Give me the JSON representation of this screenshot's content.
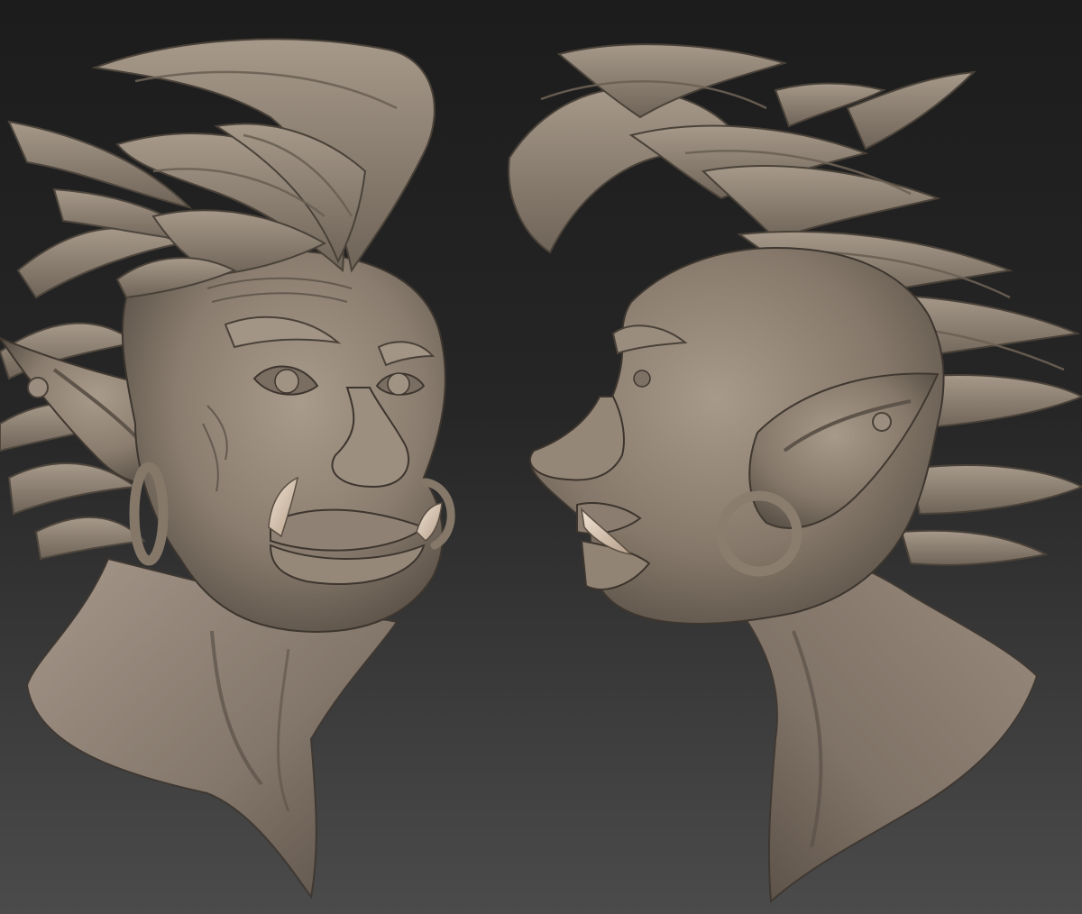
{
  "scene": {
    "background": {
      "top_color": "#1e1e1e",
      "bottom_color": "#4a4a4a"
    },
    "material": {
      "base_color": "#8a7d6f",
      "highlight_color": "#b8ab9c",
      "shadow_color": "#4a4138",
      "tusk_color": "#d9c7b4"
    },
    "views": [
      {
        "id": "three-quarter-front",
        "subject": "goblin-bust"
      },
      {
        "id": "right-profile",
        "subject": "goblin-bust"
      }
    ]
  }
}
